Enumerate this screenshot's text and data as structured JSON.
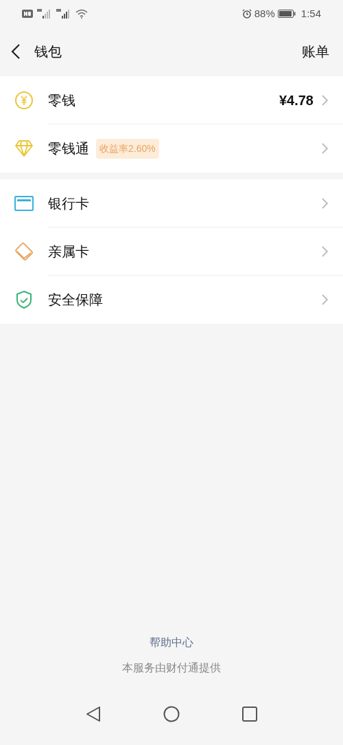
{
  "status_bar": {
    "battery": "88%",
    "time": "1:54"
  },
  "header": {
    "title": "钱包",
    "action": "账单"
  },
  "sections": [
    [
      {
        "kind": "coin",
        "label": "零钱",
        "value": "¥4.78"
      },
      {
        "kind": "diamond",
        "label": "零钱通",
        "badge": "收益率2.60%"
      }
    ],
    [
      {
        "kind": "card",
        "label": "银行卡"
      },
      {
        "kind": "cards",
        "label": "亲属卡"
      },
      {
        "kind": "shield",
        "label": "安全保障"
      }
    ]
  ],
  "footer": {
    "link": "帮助中心",
    "note": "本服务由财付通提供"
  }
}
